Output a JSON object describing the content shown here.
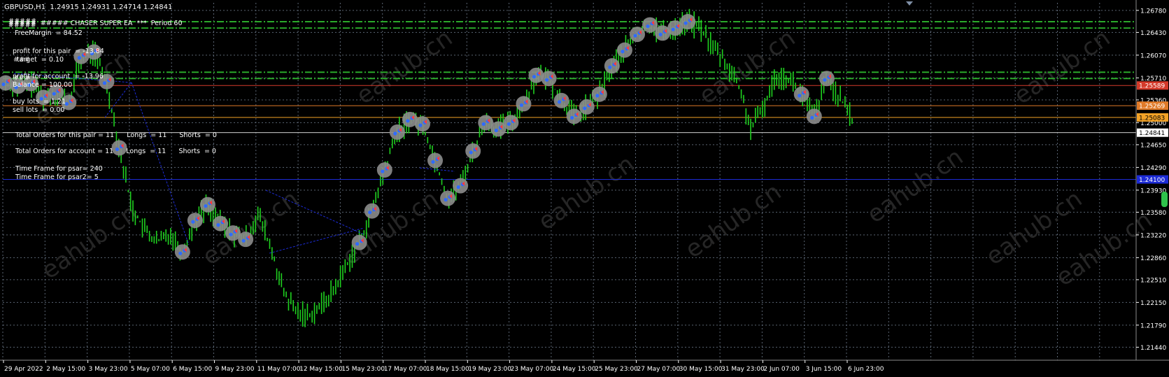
{
  "chart_header": {
    "symbol_info": "GBPUSD,H1  1.24915 1.24931 1.24714 1.24841",
    "ea_title": "#####  ##### CHASER SUPER EA  ***  Period 60",
    "overlay_fragments": [
      "#####",
      "#####",
      "###",
      "###"
    ]
  },
  "info_panel": {
    "free_margin": "FreeMargin  = 84.52",
    "profit_pair": "profit for this pair  = -13.84",
    "target": "target  = 0.10",
    "profit_account": "profit for account  = -13.96",
    "balance": "Balance = 100.00",
    "buy_lots": "buy lots  = 1.21",
    "sell_lots": "sell lots  = 0.00",
    "total_orders_pair": "Total Orders for this pair = 11      Longs  = 11      Shorts  = 0",
    "total_orders_account": "Total Orders for account = 11      Longs  = 11      Shorts  = 0",
    "tf_psar": "Time Frame for psar= 240",
    "tf_psar2": "Time Frame for psar2= 5"
  },
  "watermark": "eahub.cn",
  "price_axis": {
    "ticks": [
      "1.26780",
      "1.26430",
      "1.26070",
      "1.25710",
      "1.25360",
      "1.25000",
      "1.24650",
      "1.24290",
      "1.23930",
      "1.23580",
      "1.23220",
      "1.22860",
      "1.22510",
      "1.22150",
      "1.21790",
      "1.21440"
    ],
    "labels": [
      {
        "text": "1.25589",
        "bg": "#d43a2a",
        "fg": "#ffffff",
        "price": 1.25589
      },
      {
        "text": "1.25269",
        "bg": "#e07a28",
        "fg": "#ffffff",
        "price": 1.25269
      },
      {
        "text": "1.25083",
        "bg": "#f2a227",
        "fg": "#000000",
        "price": 1.25083
      },
      {
        "text": "1.24841",
        "bg": "#ffffff",
        "fg": "#000000",
        "price": 1.24841
      },
      {
        "text": "1.24100",
        "bg": "#1c2bd6",
        "fg": "#ffffff",
        "price": 1.241
      }
    ]
  },
  "time_axis": {
    "labels": [
      "29 Apr 2022",
      "2 May 15:00",
      "3 May 23:00",
      "5 May 07:00",
      "6 May 15:00",
      "9 May 23:00",
      "11 May 07:00",
      "12 May 15:00",
      "15 May 23:00",
      "17 May 07:00",
      "18 May 15:00",
      "19 May 23:00",
      "23 May 07:00",
      "24 May 15:00",
      "25 May 23:00",
      "27 May 07:00",
      "30 May 15:00",
      "31 May 23:00",
      "2 Jun 07:00",
      "3 Jun 15:00",
      "6 Jun 23:00"
    ]
  },
  "colors": {
    "background": "#000000",
    "grid": "#5a6472",
    "candles": "#1fd11f",
    "order_blob": "#8c8c8c",
    "buy_marker": "#2f6bff",
    "sell_marker": "#ff3b3b",
    "level_green": "#2aa82a",
    "level_red": "#d43a2a",
    "level_orange": "#e07a28",
    "level_gold": "#f2a227",
    "level_blue": "#1c2bd6",
    "bid_line": "#cfcfcf"
  },
  "chart_data": {
    "type": "line",
    "title": "",
    "xlabel": "",
    "ylabel": "",
    "ylim": [
      1.214,
      1.269
    ],
    "series": [
      {
        "values": [
          1.2563,
          1.2558,
          1.2562,
          1.254,
          1.2548,
          1.2532,
          1.2605,
          1.2612,
          1.2565,
          1.246,
          1.2365,
          1.233,
          1.231,
          1.2325,
          1.2295,
          1.2345,
          1.237,
          1.234,
          1.2325,
          1.2315,
          1.2355,
          1.23,
          1.223,
          1.22,
          1.2195,
          1.221,
          1.2235,
          1.2275,
          1.231,
          1.236,
          1.2425,
          1.2485,
          1.2505,
          1.2498,
          1.244,
          1.238,
          1.24,
          1.2455,
          1.25,
          1.249,
          1.25,
          1.253,
          1.2575,
          1.257,
          1.2535,
          1.251,
          1.2525,
          1.2545,
          1.259,
          1.2615,
          1.264,
          1.2655,
          1.2642,
          1.265,
          1.266,
          1.265,
          1.262,
          1.2595,
          1.256,
          1.249,
          1.2525,
          1.2575,
          1.257,
          1.2545,
          1.251,
          1.257,
          1.254,
          1.2505
        ]
      }
    ],
    "horizontal_levels": [
      1.266,
      1.265,
      1.258,
      1.257,
      1.25589,
      1.25269,
      1.25083,
      1.24841,
      1.241
    ]
  }
}
